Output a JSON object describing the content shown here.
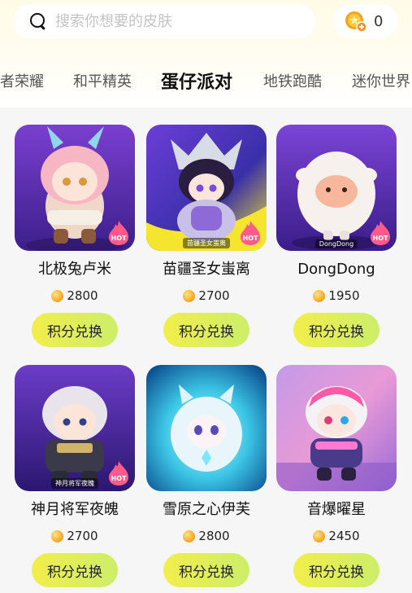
{
  "search": {
    "placeholder": "搜索你想要的皮肤",
    "icon": "search-icon"
  },
  "coins": {
    "value": "0",
    "icon": "coin-plus-icon"
  },
  "tabs": [
    {
      "label": "者荣耀",
      "active": false
    },
    {
      "label": "和平精英",
      "active": false
    },
    {
      "label": "蛋仔派对",
      "active": true
    },
    {
      "label": "地铁跑酷",
      "active": false
    },
    {
      "label": "迷你世界",
      "active": false
    }
  ],
  "items": [
    {
      "name": "北极兔卢米",
      "price": "2800",
      "button": "积分兑换",
      "badge": "HOT",
      "tag": ""
    },
    {
      "name": "苗疆圣女蚩离",
      "price": "2700",
      "button": "积分兑换",
      "badge": "HOT",
      "tag": "苗疆圣女蚩离"
    },
    {
      "name": "DongDong",
      "price": "1950",
      "button": "积分兑换",
      "badge": "HOT",
      "tag": "DongDong"
    },
    {
      "name": "神月将军夜魄",
      "price": "2700",
      "button": "积分兑换",
      "badge": "HOT",
      "tag": "神月将军夜魄"
    },
    {
      "name": "雪原之心伊芙",
      "price": "2800",
      "button": "积分兑换",
      "badge": "",
      "tag": ""
    },
    {
      "name": "音爆曜星",
      "price": "2450",
      "button": "积分兑换",
      "badge": "",
      "tag": ""
    }
  ],
  "colors": {
    "accent": "#f9e44a",
    "button_start": "#f2ee4a",
    "button_end": "#cdee6a"
  }
}
